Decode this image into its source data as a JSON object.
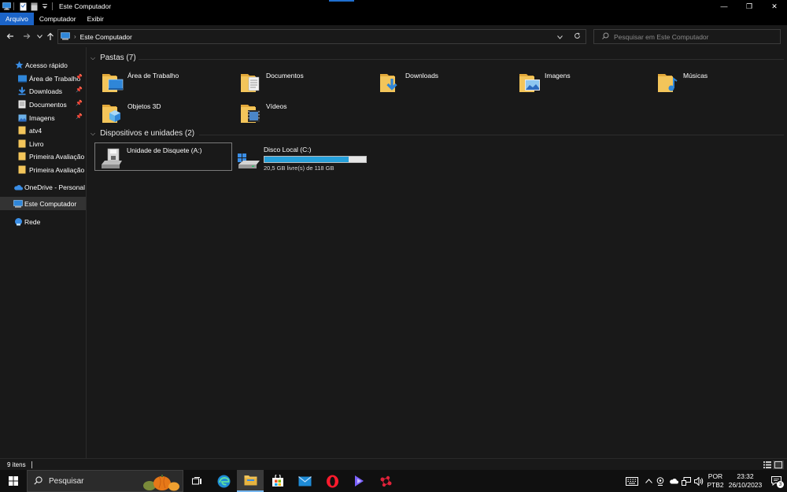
{
  "window": {
    "title": "Este Computador",
    "controls": {
      "minimize": "—",
      "maximize": "❐",
      "close": "✕"
    }
  },
  "ribbon": {
    "tabs": [
      {
        "label": "Arquivo",
        "active": true
      },
      {
        "label": "Computador",
        "active": false
      },
      {
        "label": "Exibir",
        "active": false
      }
    ]
  },
  "address": {
    "path": "Este Computador",
    "search_placeholder": "Pesquisar em Este Computador"
  },
  "sidebar": {
    "quick_access": "Acesso rápido",
    "pinned": [
      {
        "label": "Área de Trabalho",
        "icon": "desktop-icon",
        "pinned": true
      },
      {
        "label": "Downloads",
        "icon": "downloads-icon",
        "pinned": true
      },
      {
        "label": "Documentos",
        "icon": "documents-icon",
        "pinned": true
      },
      {
        "label": "Imagens",
        "icon": "pictures-icon",
        "pinned": true
      },
      {
        "label": "atv4",
        "icon": "folder-icon",
        "pinned": false
      },
      {
        "label": "Livro",
        "icon": "folder-icon",
        "pinned": false
      },
      {
        "label": "Primeira Avaliação",
        "icon": "folder-icon",
        "pinned": false
      },
      {
        "label": "Primeira Avaliação",
        "icon": "folder-icon",
        "pinned": false
      }
    ],
    "onedrive": "OneDrive - Personal",
    "this_pc": "Este Computador",
    "network": "Rede"
  },
  "main": {
    "folders_header": "Pastas (7)",
    "folders": [
      {
        "label": "Área de Trabalho",
        "icon": "desktop-folder-icon"
      },
      {
        "label": "Documentos",
        "icon": "documents-folder-icon"
      },
      {
        "label": "Downloads",
        "icon": "downloads-folder-icon"
      },
      {
        "label": "Imagens",
        "icon": "pictures-folder-icon"
      },
      {
        "label": "Músicas",
        "icon": "music-folder-icon"
      },
      {
        "label": "Objetos 3D",
        "icon": "3d-objects-folder-icon"
      },
      {
        "label": "Vídeos",
        "icon": "videos-folder-icon"
      }
    ],
    "devices_header": "Dispositivos e unidades (2)",
    "devices": [
      {
        "label": "Unidade de Disquete (A:)",
        "icon": "floppy-drive-icon"
      },
      {
        "label": "Disco Local (C:)",
        "icon": "local-disk-icon",
        "space": "20,5 GB livre(s) de 118 GB",
        "used_fraction": 0.826
      }
    ]
  },
  "status": {
    "items": "9 itens"
  },
  "taskbar": {
    "search": "Pesquisar",
    "language": "POR",
    "layout": "PTB2",
    "time": "23:32",
    "date": "26/10/2023",
    "notifications": "3"
  },
  "colors": {
    "accent": "#1b64c8",
    "folder": "#f3c55a",
    "disk_bar": "#26a0da"
  }
}
